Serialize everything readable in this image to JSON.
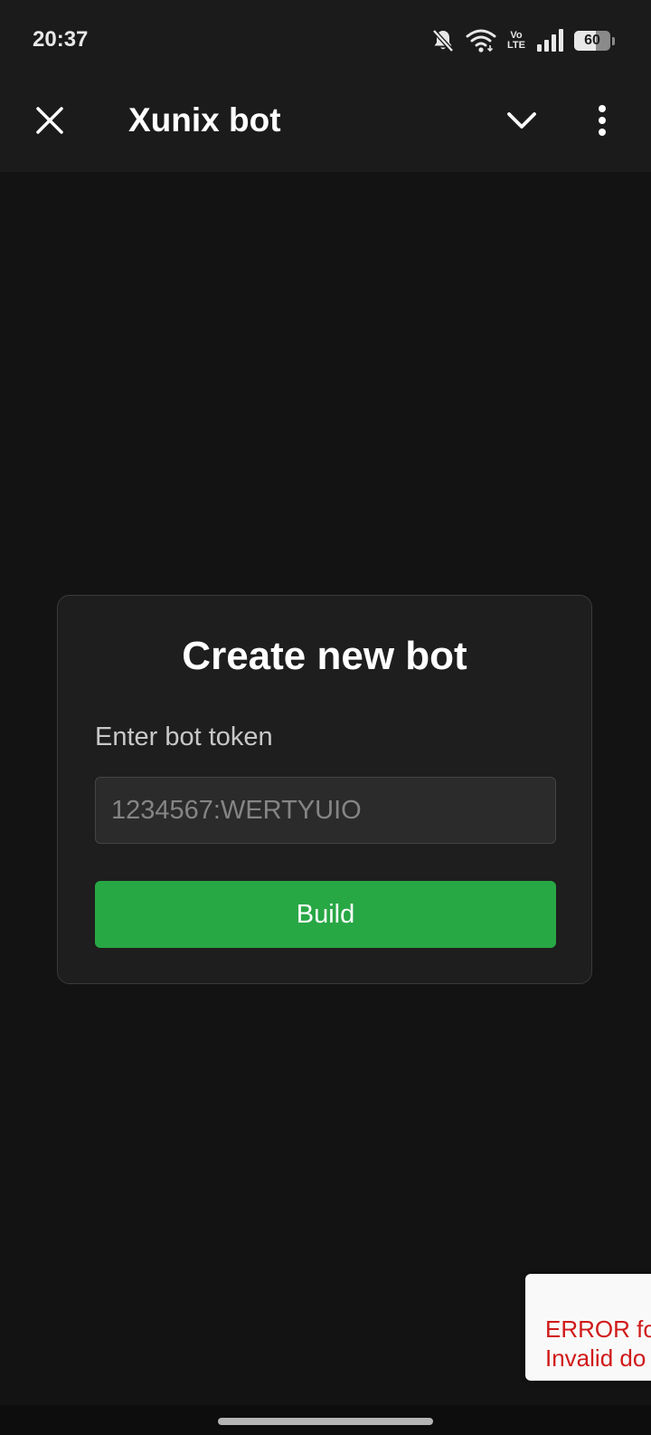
{
  "status_bar": {
    "time": "20:37",
    "icons": [
      "bell-off-icon",
      "wifi-icon",
      "volte-icon",
      "signal-icon",
      "battery-icon"
    ],
    "volte_top": "Vo",
    "volte_bottom": "LTE",
    "battery_level": "60",
    "battery_fraction": 0.6
  },
  "app_bar": {
    "title": "Xunix bot",
    "close_icon": "close-icon",
    "collapse_icon": "chevron-down-icon",
    "menu_icon": "more-vertical-icon"
  },
  "card": {
    "title": "Create new bot",
    "token_label": "Enter bot token",
    "token_value": "",
    "token_placeholder": "1234567:WERTYUIO",
    "build_label": "Build"
  },
  "error_toast": {
    "line1": "ERROR fo",
    "line2": "Invalid do"
  },
  "colors": {
    "background": "#131313",
    "bar": "#1b1b1b",
    "card": "#1e1e1e",
    "accent_green": "#28a745",
    "error_red": "#d01919"
  }
}
